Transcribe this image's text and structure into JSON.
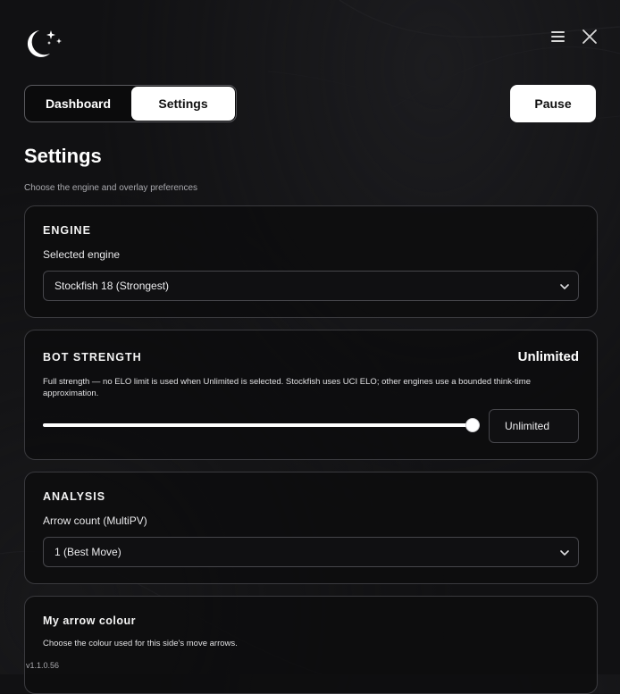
{
  "header": {
    "logo_icon": "moon-stars-icon",
    "menu_icon": "hamburger-icon",
    "close_icon": "close-icon"
  },
  "tabs": [
    {
      "label": "Dashboard",
      "active": false
    },
    {
      "label": "Settings",
      "active": true
    }
  ],
  "pause_label": "Pause",
  "page": {
    "title": "Settings",
    "subtitle": "Choose the engine and overlay preferences"
  },
  "engine": {
    "title": "ENGINE",
    "label": "Selected engine",
    "selected": "Stockfish 18 (Strongest)"
  },
  "strength": {
    "title": "BOT STRENGTH",
    "value": "Unlimited",
    "description": "Full strength — no ELO limit is used when Unlimited is selected. Stockfish uses UCI ELO; other engines use a bounded think-time approximation.",
    "slider_fraction": 1.0,
    "input_value": "Unlimited"
  },
  "analysis": {
    "title": "ANALYSIS",
    "label": "Arrow count (MultiPV)",
    "selected": "1 (Best Move)"
  },
  "arrow_colour": {
    "title": "My arrow colour",
    "description": "Choose the colour used for this side's move arrows."
  },
  "version": "v1.1.0.56",
  "colors": {
    "background": "#111113",
    "card_border": "#3a3a3e",
    "accent": "#ffffff"
  }
}
